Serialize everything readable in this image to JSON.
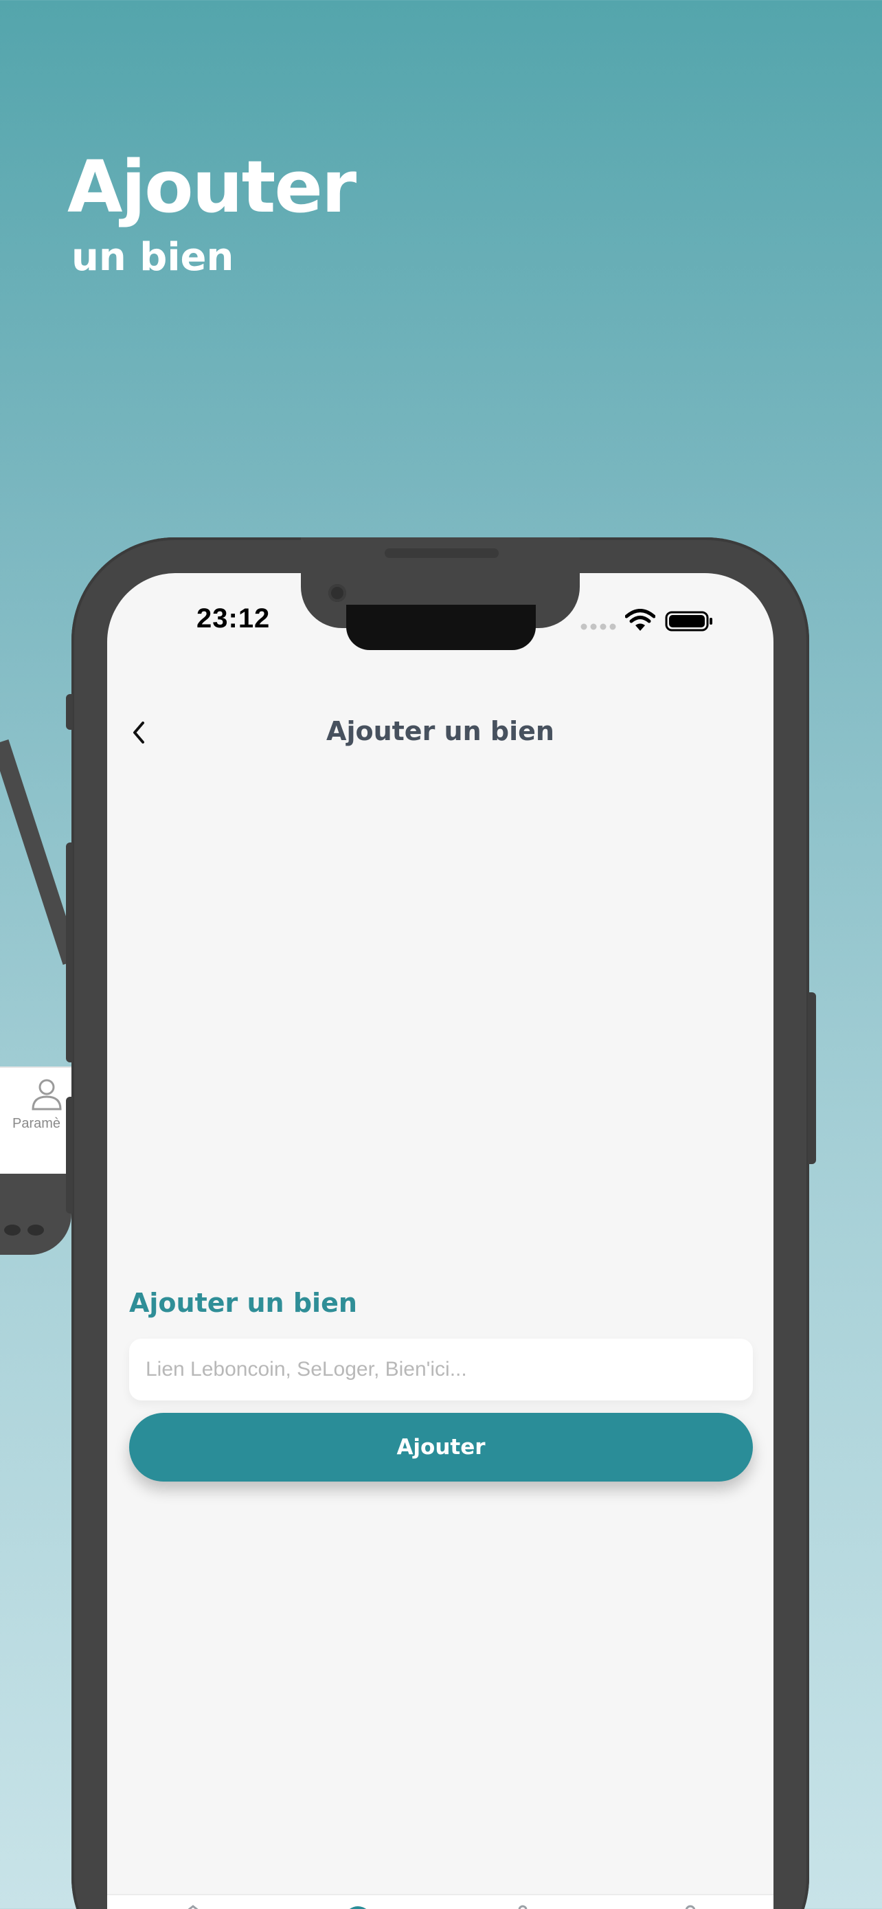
{
  "headline": {
    "title": "Ajouter",
    "subtitle": "un bien"
  },
  "background_phone": {
    "tab_label": "Paramè",
    "tab_icon": "person-icon"
  },
  "status_bar": {
    "time": "23:12",
    "icons": [
      "signal-dots-icon",
      "wifi-icon",
      "battery-icon"
    ]
  },
  "nav": {
    "title": "Ajouter un bien",
    "back_icon": "chevron-left-icon"
  },
  "form": {
    "section_title": "Ajouter un bien",
    "link_input": {
      "value": "",
      "placeholder": "Lien Leboncoin, SeLoger, Bien'ici..."
    },
    "submit_label": "Ajouter"
  },
  "colors": {
    "accent": "#2a8d98",
    "section_title": "#2f8e97",
    "nav_title": "#47515e",
    "screen_background": "#f6f6f6",
    "phone_frame": "#454545"
  }
}
